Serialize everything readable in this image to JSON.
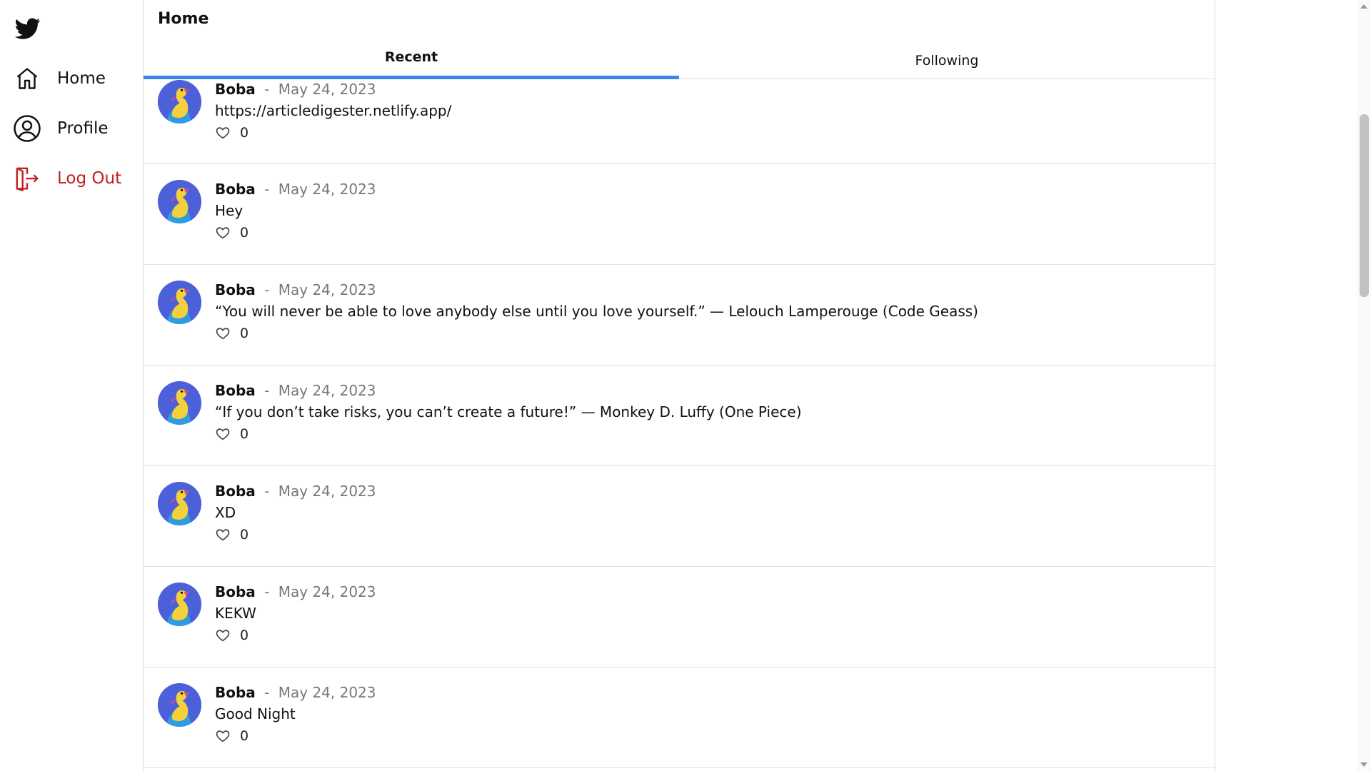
{
  "nav": {
    "logo_icon": "twitter-bird-icon",
    "items": [
      {
        "label": "Home",
        "icon": "home-icon"
      },
      {
        "label": "Profile",
        "icon": "user-circle-icon"
      },
      {
        "label": "Log Out",
        "icon": "logout-icon",
        "color": "#c41e1e"
      }
    ]
  },
  "header": {
    "title": "Home"
  },
  "tabs": [
    {
      "label": "Recent",
      "active": true
    },
    {
      "label": "Following",
      "active": false
    }
  ],
  "accent_color": "#3b86e4",
  "posts": [
    {
      "author": "Boba",
      "separator": "-",
      "date": "May 24, 2023",
      "text": "https://articledigester.netlify.app/",
      "likes": "0"
    },
    {
      "author": "Boba",
      "separator": "-",
      "date": "May 24, 2023",
      "text": "Hey",
      "likes": "0"
    },
    {
      "author": "Boba",
      "separator": "-",
      "date": "May 24, 2023",
      "text": "“You will never be able to love anybody else until you love yourself.” — Lelouch Lamperouge (Code Geass)",
      "likes": "0"
    },
    {
      "author": "Boba",
      "separator": "-",
      "date": "May 24, 2023",
      "text": "“If you don’t take risks, you can’t create a future!” — Monkey D. Luffy (One Piece)",
      "likes": "0"
    },
    {
      "author": "Boba",
      "separator": "-",
      "date": "May 24, 2023",
      "text": "XD",
      "likes": "0"
    },
    {
      "author": "Boba",
      "separator": "-",
      "date": "May 24, 2023",
      "text": "KEKW",
      "likes": "0"
    },
    {
      "author": "Boba",
      "separator": "-",
      "date": "May 24, 2023",
      "text": "Good Night",
      "likes": "0"
    }
  ]
}
